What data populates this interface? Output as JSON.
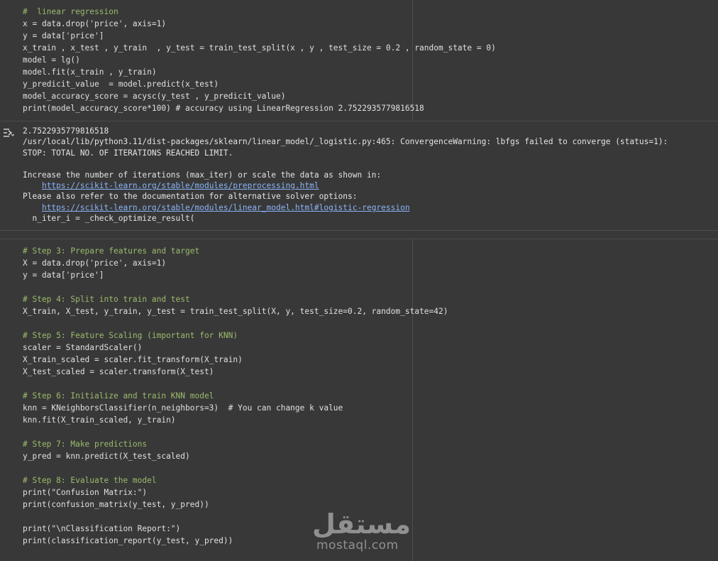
{
  "cell1": {
    "lines": [
      "#  linear regression",
      "x = data.drop('price', axis=1)",
      "y = data['price']",
      "x_train , x_test , y_train  , y_test = train_test_split(x , y , test_size = 0.2 , random_state = 0)",
      "model = lg()",
      "model.fit(x_train , y_train)",
      "y_predicit_value  = model.predict(x_test)",
      "model_accuracy_score = acysc(y_test , y_predicit_value)",
      "print(model_accuracy_score*100) # accuracy using LinearRegression 2.7522935779816518"
    ],
    "output": {
      "result": "2.7522935779816518",
      "warning_path": "/usr/local/lib/python3.11/dist-packages/sklearn/linear_model/_logistic.py:465: ConvergenceWarning: lbfgs failed to converge (status=1):",
      "warning_stop": "STOP: TOTAL NO. OF ITERATIONS REACHED LIMIT.",
      "increase": "Increase the number of iterations (max_iter) or scale the data as shown in:",
      "link1": "https://scikit-learn.org/stable/modules/preprocessing.html",
      "refer": "Please also refer to the documentation for alternative solver options:",
      "link2": "https://scikit-learn.org/stable/modules/linear_model.html#logistic-regression",
      "niter": "n_iter_i = _check_optimize_result("
    }
  },
  "cell2": {
    "lines": [
      "# Step 3: Prepare features and target",
      "X = data.drop('price', axis=1)",
      "y = data['price']",
      "",
      "# Step 4: Split into train and test",
      "X_train, X_test, y_train, y_test = train_test_split(X, y, test_size=0.2, random_state=42)",
      "",
      "# Step 5: Feature Scaling (important for KNN)",
      "scaler = StandardScaler()",
      "X_train_scaled = scaler.fit_transform(X_train)",
      "X_test_scaled = scaler.transform(X_test)",
      "",
      "# Step 6: Initialize and train KNN model",
      "knn = KNeighborsClassifier(n_neighbors=3)  # You can change k value",
      "knn.fit(X_train_scaled, y_train)",
      "",
      "# Step 7: Make predictions",
      "y_pred = knn.predict(X_test_scaled)",
      "",
      "# Step 8: Evaluate the model",
      "print(\"Confusion Matrix:\")",
      "print(confusion_matrix(y_test, y_pred))",
      "",
      "print(\"\\nClassification Report:\")",
      "print(classification_report(y_test, y_pred))"
    ]
  },
  "watermark": {
    "arabic": "مستقل",
    "latin": "mostaql.com"
  }
}
